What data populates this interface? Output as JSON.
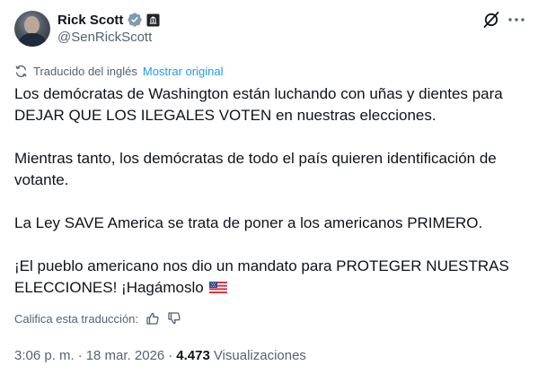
{
  "author": {
    "display_name": "Rick Scott",
    "handle": "@SenRickScott",
    "badge_color": "#829aab",
    "icons": [
      "verified-badge-icon",
      "government-affiliation-icon"
    ]
  },
  "actions": {
    "icons": [
      "grok-icon",
      "more-icon"
    ]
  },
  "translation": {
    "translated_from": "Traducido del inglés",
    "show_original": "Mostrar original",
    "rate_label": "Califica esta traducción:",
    "icons": [
      "translate-icon",
      "thumbs-up-icon",
      "thumbs-down-icon"
    ]
  },
  "tweet": {
    "paragraphs": [
      "Los demócratas de Washington están luchando con uñas y dientes para DEJAR QUE LOS ILEGALES VOTEN en nuestras elecciones.",
      "Mientras tanto, los demócratas de todo el país quieren identificación de votante.",
      "La Ley SAVE America se trata de poner a los americanos PRIMERO.",
      "¡El pueblo americano nos dio un mandato para PROTEGER NUESTRAS ELECCIONES! ¡Hagámoslo"
    ],
    "trailing_emoji": "us-flag-icon"
  },
  "meta": {
    "time": "3:06 p. m.",
    "separator": "·",
    "date": "18 mar. 2026",
    "views_count": "4.473",
    "views_label": "Visualizaciones"
  },
  "colors": {
    "text": "#0f1419",
    "secondary": "#536471",
    "link": "#1d9bf0"
  }
}
